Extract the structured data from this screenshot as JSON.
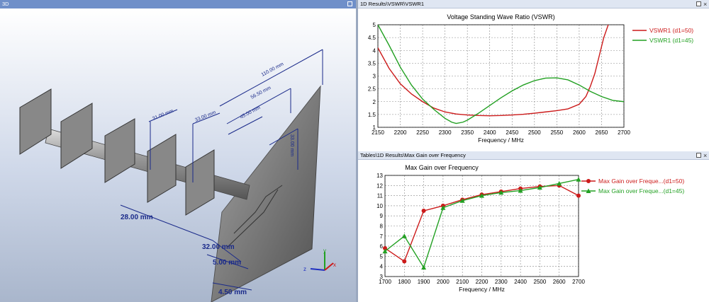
{
  "left_panel": {
    "title": "3D",
    "dimensions": [
      "110.00 mm",
      "56.50 mm",
      "45.00 mm",
      "31.00 mm",
      "33.00 mm",
      "33.00 mm",
      "28.00 mm",
      "32.00 mm",
      "5.00 mm",
      "4.50 mm"
    ],
    "axes": {
      "x": "x",
      "y": "y",
      "z": "z"
    }
  },
  "top_panel": {
    "title": "1D Results\\VSWR\\VSWR1"
  },
  "bottom_panel": {
    "title": "Tables\\1D Results\\Max Gain over Frequency"
  },
  "colors": {
    "red": "#cc1a1a",
    "green": "#22a022",
    "axis": "#000000",
    "grid": "#999999"
  },
  "chart_data": [
    {
      "type": "line",
      "title": "Voltage Standing Wave Ratio (VSWR)",
      "xlabel": "Frequency / MHz",
      "ylabel": "",
      "xlim": [
        2150,
        2700
      ],
      "ylim": [
        1,
        5
      ],
      "xticks": [
        "2150",
        "2200",
        "2250",
        "2300",
        "2350",
        "2400",
        "2450",
        "2500",
        "2550",
        "2600",
        "2650",
        "2700"
      ],
      "yticks": [
        "1",
        "1.5",
        "2",
        "2.5",
        "3",
        "3.5",
        "4",
        "4.5",
        "5"
      ],
      "grid": true,
      "legend": "right",
      "series": [
        {
          "name": "VSWR1 (d1=50)",
          "color": "#cc1a1a",
          "x": [
            2150,
            2175,
            2200,
            2225,
            2250,
            2275,
            2300,
            2325,
            2350,
            2375,
            2400,
            2425,
            2450,
            2475,
            2500,
            2525,
            2550,
            2575,
            2600,
            2615,
            2625,
            2635,
            2645,
            2655,
            2665
          ],
          "y": [
            4.1,
            3.3,
            2.7,
            2.3,
            2.0,
            1.75,
            1.6,
            1.52,
            1.48,
            1.46,
            1.45,
            1.46,
            1.48,
            1.51,
            1.55,
            1.6,
            1.65,
            1.72,
            1.9,
            2.2,
            2.6,
            3.1,
            3.8,
            4.5,
            5.0
          ]
        },
        {
          "name": "VSWR1 (d1=45)",
          "color": "#22a022",
          "x": [
            2150,
            2175,
            2200,
            2225,
            2250,
            2275,
            2300,
            2315,
            2325,
            2340,
            2350,
            2375,
            2400,
            2425,
            2450,
            2475,
            2500,
            2525,
            2550,
            2575,
            2600,
            2625,
            2650,
            2675,
            2700
          ],
          "y": [
            5.0,
            4.2,
            3.35,
            2.65,
            2.1,
            1.7,
            1.35,
            1.2,
            1.15,
            1.2,
            1.28,
            1.55,
            1.85,
            2.15,
            2.42,
            2.65,
            2.82,
            2.92,
            2.93,
            2.85,
            2.65,
            2.4,
            2.2,
            2.05,
            2.0
          ]
        }
      ]
    },
    {
      "type": "line",
      "title": "Max Gain over Frequency",
      "xlabel": "Frequency / MHz",
      "ylabel": "",
      "xlim": [
        1700,
        2700
      ],
      "ylim": [
        3,
        13
      ],
      "xticks": [
        "1700",
        "1800",
        "1900",
        "2000",
        "2100",
        "2200",
        "2300",
        "2400",
        "2500",
        "2600",
        "2700"
      ],
      "yticks": [
        "3",
        "4",
        "5",
        "6",
        "7",
        "8",
        "9",
        "10",
        "11",
        "12",
        "13"
      ],
      "grid": true,
      "legend": "right",
      "series": [
        {
          "name": "Max Gain over Freque...(d1=50)",
          "color": "#cc1a1a",
          "marker": "circle",
          "x": [
            1700,
            1800,
            1900,
            2000,
            2100,
            2200,
            2300,
            2400,
            2500,
            2600,
            2700
          ],
          "y": [
            5.8,
            4.5,
            9.5,
            10.0,
            10.6,
            11.1,
            11.4,
            11.7,
            11.9,
            12.0,
            11.0
          ]
        },
        {
          "name": "Max Gain over Freque...(d1=45)",
          "color": "#22a022",
          "marker": "triangle",
          "x": [
            1700,
            1800,
            1900,
            2000,
            2100,
            2200,
            2300,
            2400,
            2500,
            2600,
            2700
          ],
          "y": [
            5.5,
            7.0,
            3.9,
            9.8,
            10.5,
            11.0,
            11.3,
            11.5,
            11.8,
            12.2,
            12.6
          ]
        }
      ]
    }
  ]
}
